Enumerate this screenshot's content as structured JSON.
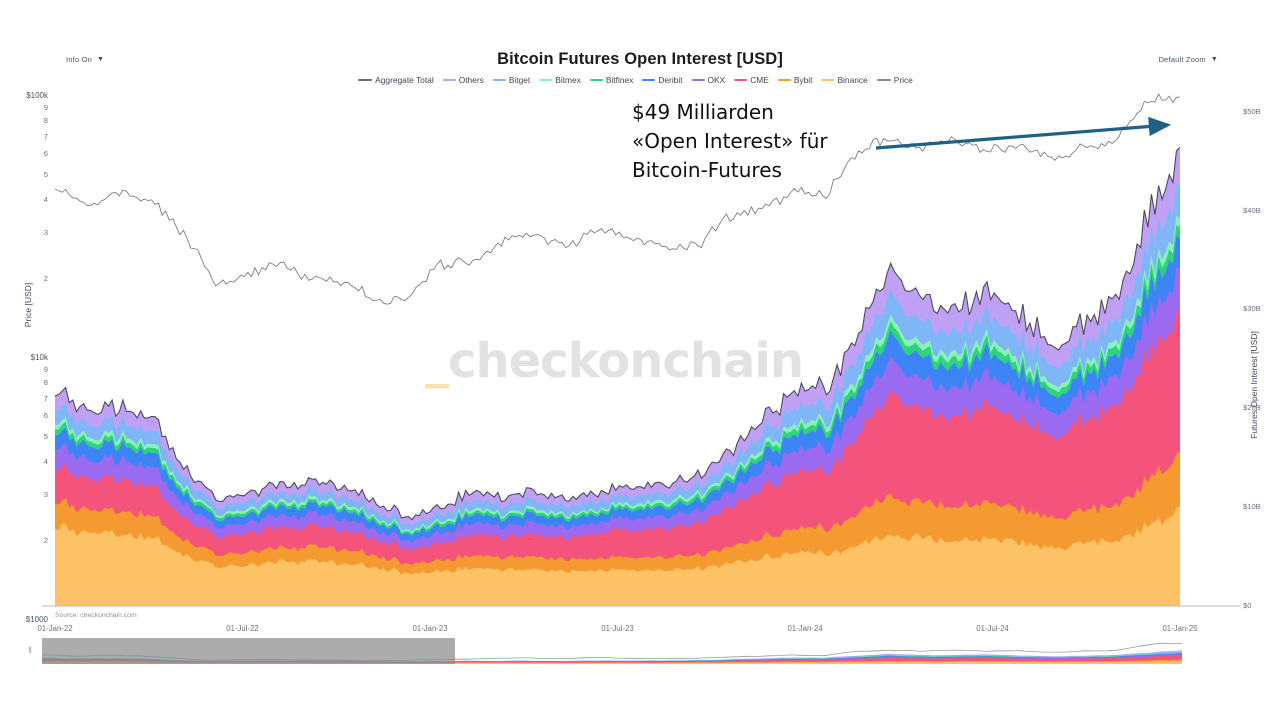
{
  "controls": {
    "info": {
      "label": "Info On",
      "caret": "▼"
    },
    "zoom": {
      "label": "Default Zoom",
      "caret": "▼"
    },
    "range_handle": "‖"
  },
  "header": {
    "title": "Bitcoin Futures Open Interest [USD]"
  },
  "axes": {
    "y_left_title": "Price [USD]",
    "y_right_title": "Futures Open Interest [USD]",
    "y_left_ticks": [
      "$100k",
      "9",
      "8",
      "7",
      "6",
      "5",
      "4",
      "3",
      "2",
      "$10k",
      "9",
      "8",
      "7",
      "6",
      "5",
      "4",
      "3",
      "2",
      "$1000"
    ],
    "y_right_ticks": [
      "$50B",
      "$40B",
      "$30B",
      "$20B",
      "$10B",
      "$0"
    ],
    "x_ticks": [
      "01-Jan-22",
      "01-Jul-22",
      "01-Jan-23",
      "01-Jul-23",
      "01-Jan-24",
      "01-Jul-24",
      "01-Jan-25"
    ]
  },
  "annotation": {
    "line1": "$49 Milliarden",
    "line2": "«Open Interest» für",
    "line3": "Bitcoin-Futures",
    "arrow_color": "#1f6184"
  },
  "watermark": {
    "underscore": "_",
    "text": "checkonchain"
  },
  "source": {
    "text": "Source: checkonchain.com"
  },
  "chart_data": {
    "type": "area",
    "title": "Bitcoin Futures Open Interest [USD]",
    "subtype": "stacked-area-with-overlaid-line",
    "xlabel": "",
    "ylabel": "Futures Open Interest [USD]",
    "y2label": "Price [USD]",
    "grid": false,
    "legend_position": "top-center",
    "x_range": [
      "01-Jan-22",
      "01-Jan-25"
    ],
    "ylim_right": [
      0,
      52
    ],
    "ylim_left_log": [
      1000,
      100000
    ],
    "right_axis_units": "USD billions",
    "left_axis_units": "USD",
    "left_axis_scale": "log",
    "x": [
      "2022-01-01",
      "2022-02-01",
      "2022-03-01",
      "2022-04-01",
      "2022-05-01",
      "2022-06-01",
      "2022-07-01",
      "2022-08-01",
      "2022-09-01",
      "2022-10-01",
      "2022-11-01",
      "2022-12-01",
      "2023-01-01",
      "2023-02-01",
      "2023-03-01",
      "2023-04-01",
      "2023-05-01",
      "2023-06-01",
      "2023-07-01",
      "2023-08-01",
      "2023-09-01",
      "2023-10-01",
      "2023-11-01",
      "2023-12-01",
      "2024-01-01",
      "2024-02-01",
      "2024-03-01",
      "2024-04-01",
      "2024-05-01",
      "2024-06-01",
      "2024-07-01",
      "2024-08-01",
      "2024-09-01",
      "2024-10-01",
      "2024-11-01",
      "2024-12-01"
    ],
    "series": [
      {
        "name": "Binance",
        "color": "#fcc265",
        "values": [
          8.2,
          7.2,
          7.4,
          7.0,
          5.3,
          4.0,
          4.2,
          4.6,
          4.4,
          4.3,
          4.0,
          3.3,
          3.5,
          3.9,
          3.6,
          3.8,
          3.5,
          3.6,
          3.6,
          3.6,
          3.8,
          4.3,
          4.9,
          5.3,
          5.4,
          6.0,
          7.1,
          6.9,
          6.6,
          6.7,
          6.5,
          6.0,
          6.2,
          6.6,
          8.1,
          9.6
        ]
      },
      {
        "name": "Bybit",
        "color": "#f59a30",
        "values": [
          2.6,
          2.3,
          2.4,
          2.2,
          1.6,
          1.2,
          1.3,
          1.4,
          1.4,
          1.4,
          1.2,
          1.0,
          1.1,
          1.3,
          1.2,
          1.3,
          1.2,
          1.2,
          1.3,
          1.3,
          1.4,
          1.6,
          2.1,
          2.4,
          2.6,
          3.2,
          4.0,
          3.6,
          3.5,
          3.6,
          3.4,
          3.0,
          3.2,
          3.6,
          4.6,
          5.5
        ]
      },
      {
        "name": "CME",
        "color": "#f4547b",
        "values": [
          3.6,
          3.1,
          3.3,
          3.1,
          2.3,
          1.8,
          1.9,
          2.1,
          2.0,
          1.9,
          1.7,
          1.5,
          1.7,
          2.1,
          2.0,
          2.3,
          2.2,
          2.6,
          2.8,
          2.9,
          3.2,
          4.0,
          5.0,
          5.6,
          5.8,
          7.8,
          10.5,
          9.2,
          9.0,
          9.6,
          9.2,
          8.3,
          8.9,
          9.8,
          12.5,
          14.2
        ]
      },
      {
        "name": "OKX",
        "color": "#9a6bf0",
        "values": [
          2.2,
          1.9,
          2.0,
          1.9,
          1.4,
          1.0,
          1.1,
          1.2,
          1.2,
          1.2,
          1.0,
          0.9,
          1.0,
          1.2,
          1.1,
          1.2,
          1.1,
          1.1,
          1.2,
          1.2,
          1.3,
          1.5,
          1.9,
          2.2,
          2.3,
          2.8,
          3.4,
          3.0,
          2.9,
          3.0,
          2.8,
          2.5,
          2.6,
          2.9,
          3.7,
          4.3
        ]
      },
      {
        "name": "Deribit",
        "color": "#3d85f7",
        "values": [
          1.6,
          1.4,
          1.5,
          1.4,
          1.0,
          0.8,
          0.8,
          0.9,
          0.9,
          0.9,
          0.8,
          0.7,
          0.7,
          0.9,
          0.8,
          0.9,
          0.8,
          0.8,
          0.9,
          0.9,
          1.0,
          1.1,
          1.4,
          1.6,
          1.7,
          2.0,
          2.5,
          2.2,
          2.1,
          2.2,
          2.1,
          1.8,
          1.9,
          2.1,
          2.7,
          3.1
        ]
      },
      {
        "name": "Bitfinex",
        "color": "#2ed47a",
        "values": [
          0.6,
          0.5,
          0.5,
          0.5,
          0.4,
          0.3,
          0.3,
          0.3,
          0.3,
          0.3,
          0.3,
          0.2,
          0.3,
          0.3,
          0.3,
          0.3,
          0.3,
          0.3,
          0.3,
          0.3,
          0.4,
          0.4,
          0.5,
          0.6,
          0.6,
          0.7,
          0.9,
          0.8,
          0.8,
          0.8,
          0.7,
          0.6,
          0.7,
          0.8,
          1.0,
          1.1
        ]
      },
      {
        "name": "Bitmex",
        "color": "#8bf0bb",
        "values": [
          0.5,
          0.4,
          0.5,
          0.4,
          0.3,
          0.2,
          0.3,
          0.3,
          0.3,
          0.3,
          0.2,
          0.2,
          0.2,
          0.3,
          0.2,
          0.3,
          0.2,
          0.2,
          0.3,
          0.3,
          0.3,
          0.3,
          0.4,
          0.5,
          0.5,
          0.6,
          0.7,
          0.6,
          0.6,
          0.6,
          0.6,
          0.5,
          0.5,
          0.6,
          0.8,
          0.9
        ]
      },
      {
        "name": "Bitget",
        "color": "#7fb6f7",
        "values": [
          1.5,
          1.3,
          1.4,
          1.3,
          1.0,
          0.7,
          0.8,
          0.8,
          0.8,
          0.8,
          0.7,
          0.6,
          0.7,
          0.8,
          0.8,
          0.8,
          0.8,
          0.8,
          0.8,
          0.8,
          0.9,
          1.1,
          1.4,
          1.6,
          1.7,
          2.1,
          2.6,
          2.3,
          2.2,
          2.3,
          2.2,
          1.9,
          2.0,
          2.2,
          2.8,
          3.3
        ]
      },
      {
        "name": "Others",
        "color": "#bfa0f5",
        "values": [
          1.6,
          1.4,
          1.5,
          1.4,
          1.0,
          0.8,
          0.8,
          0.9,
          0.9,
          0.9,
          0.8,
          0.7,
          0.7,
          0.9,
          0.8,
          0.9,
          0.8,
          0.8,
          0.9,
          0.9,
          1.0,
          1.2,
          1.5,
          1.7,
          1.8,
          2.2,
          2.7,
          2.4,
          2.3,
          2.4,
          2.3,
          2.0,
          2.1,
          2.3,
          3.0,
          3.5
        ]
      }
    ],
    "aggregate_total": {
      "name": "Aggregate Total",
      "color": "#4b4b5a"
    },
    "price_line": {
      "name": "Price",
      "color": "#6a6a6a",
      "unit": "USD",
      "values": [
        46000,
        38500,
        43000,
        39500,
        30000,
        19000,
        21000,
        23000,
        19500,
        19400,
        16500,
        16800,
        23000,
        23500,
        28000,
        29500,
        27000,
        30500,
        29300,
        26000,
        27000,
        34500,
        37500,
        42500,
        42800,
        61500,
        70000,
        63500,
        67500,
        62000,
        64000,
        59000,
        63500,
        68000,
        96000,
        98500
      ]
    },
    "callout": {
      "value_usd_billions": 49,
      "text": "$49 Milliarden «Open Interest» für Bitcoin-Futures"
    }
  },
  "legend": [
    {
      "label": "Aggregate Total",
      "color": "#6b6b6b",
      "style": "line"
    },
    {
      "label": "Others",
      "color": "#bfa0f5",
      "style": "area"
    },
    {
      "label": "Bitget",
      "color": "#7fb6f7",
      "style": "area"
    },
    {
      "label": "Bitmex",
      "color": "#8bf0bb",
      "style": "area"
    },
    {
      "label": "Bitfinex",
      "color": "#2ed47a",
      "style": "area"
    },
    {
      "label": "Deribit",
      "color": "#3d85f7",
      "style": "area"
    },
    {
      "label": "OKX",
      "color": "#9a6bf0",
      "style": "area"
    },
    {
      "label": "CME",
      "color": "#f4547b",
      "style": "area"
    },
    {
      "label": "Bybit",
      "color": "#f59a30",
      "style": "area"
    },
    {
      "label": "Binance",
      "color": "#fcc265",
      "style": "area"
    },
    {
      "label": "Price",
      "color": "#8a8a8a",
      "style": "line"
    }
  ]
}
